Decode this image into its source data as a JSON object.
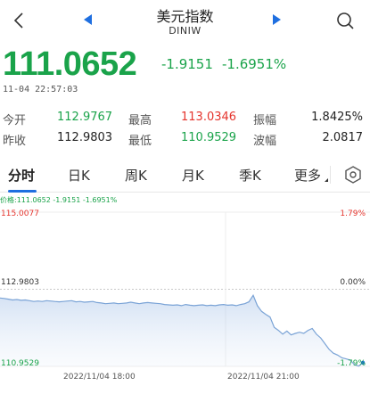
{
  "header": {
    "title": "美元指数",
    "subtitle": "DINIW"
  },
  "quote": {
    "price": "111.0652",
    "change": "-1.9151",
    "change_pct": "-1.6951%",
    "time": "11-04 22:57:03"
  },
  "stats": {
    "open_label": "今开",
    "open": "112.9767",
    "high_label": "最高",
    "high": "113.0346",
    "amp_label": "振幅",
    "amp": "1.8425%",
    "prev_label": "昨收",
    "prev": "112.9803",
    "low_label": "最低",
    "low": "110.9529",
    "wave_label": "波幅",
    "wave": "2.0817"
  },
  "tabs": [
    {
      "label": "分时"
    },
    {
      "label": "日K"
    },
    {
      "label": "周K"
    },
    {
      "label": "月K"
    },
    {
      "label": "季K"
    },
    {
      "label": "更多"
    }
  ],
  "legend": {
    "text": "价格:111.0652  -1.9151  -1.6951%"
  },
  "colors": {
    "up": "#e5342d",
    "down": "#1aa34a",
    "accent": "#1f6fe0",
    "line": "#7aa3d6"
  },
  "chart_data": {
    "type": "area",
    "y_left_ticks": [
      "115.0077",
      "112.9803",
      "110.9529"
    ],
    "y_right_ticks": [
      "1.79%",
      "0.00%",
      "-1.79%"
    ],
    "x_ticks": [
      "2022/11/04 18:00",
      "2022/11/04 21:00"
    ],
    "ylim": [
      110.9529,
      115.0077
    ],
    "prev_close": 112.9803,
    "series": [
      {
        "values": [
          112.75,
          112.74,
          112.72,
          112.7,
          112.71,
          112.69,
          112.7,
          112.68,
          112.66,
          112.67,
          112.66,
          112.68,
          112.67,
          112.66,
          112.65,
          112.66,
          112.67,
          112.68,
          112.65,
          112.66,
          112.64,
          112.65,
          112.66,
          112.63,
          112.62,
          112.6,
          112.61,
          112.62,
          112.6,
          112.61,
          112.62,
          112.64,
          112.62,
          112.6,
          112.62,
          112.63,
          112.62,
          112.61,
          112.6,
          112.58,
          112.57,
          112.56,
          112.57,
          112.55,
          112.58,
          112.56,
          112.55,
          112.56,
          112.57,
          112.55,
          112.56,
          112.55,
          112.57,
          112.58,
          112.56,
          112.57,
          112.55,
          112.58,
          112.6,
          112.65,
          112.82,
          112.55,
          112.4,
          112.32,
          112.25,
          111.98,
          111.9,
          111.8,
          111.88,
          111.78,
          111.82,
          111.85,
          111.82,
          111.9,
          111.95,
          111.8,
          111.7,
          111.55,
          111.4,
          111.3,
          111.25,
          111.18,
          111.15,
          111.12,
          111.0,
          110.96,
          111.05
        ]
      }
    ]
  }
}
